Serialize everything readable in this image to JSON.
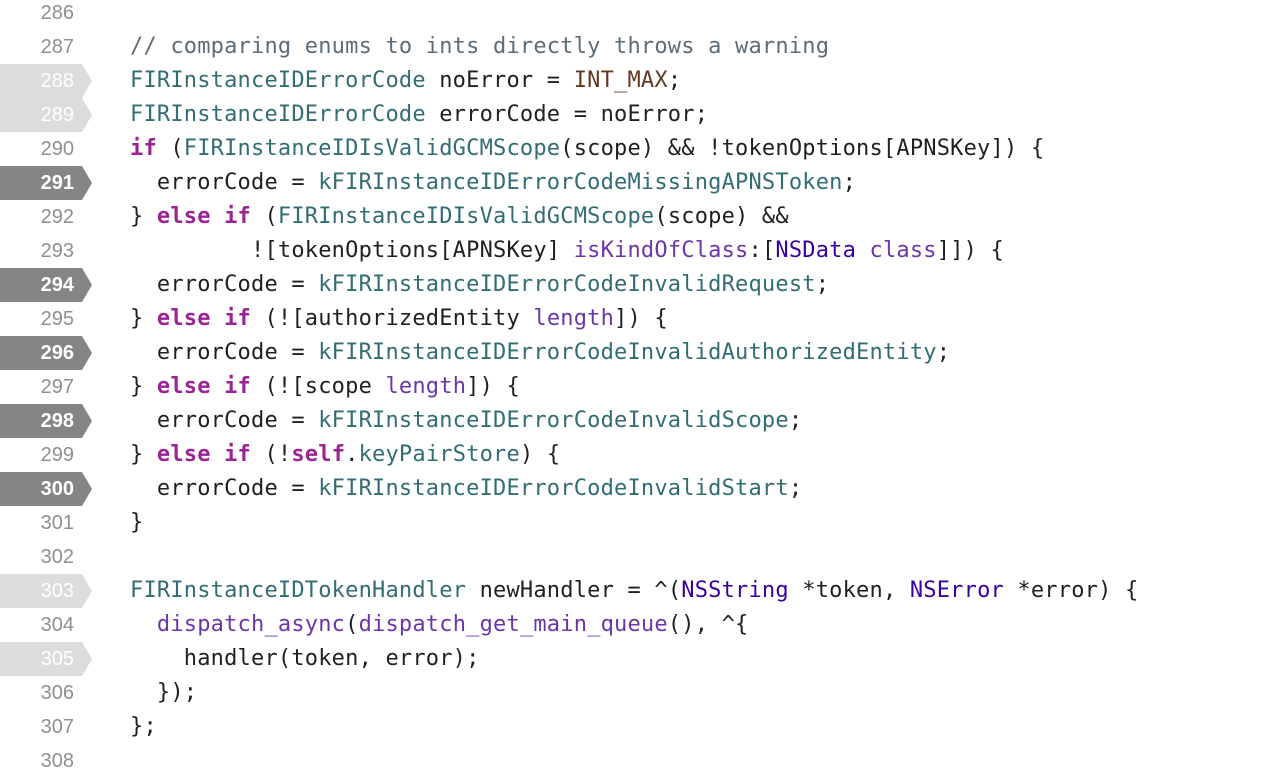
{
  "colors": {
    "background": "#ffffff",
    "gutter_text": "#8f8f8f",
    "breakpoint_active": "#858585",
    "breakpoint_inactive": "#dcdcdc",
    "plain": "#1f1f24",
    "comment": "#5d6c79",
    "keyword": "#9b2393",
    "type": "#326d74",
    "macro": "#643820",
    "func": "#6c36a9",
    "class": "#3900a0"
  },
  "lines": [
    {
      "num": "286",
      "bp": "none",
      "tokens": []
    },
    {
      "num": "287",
      "bp": "none",
      "tokens": [
        {
          "c": "comment",
          "t": "// comparing enums to ints directly throws a warning"
        }
      ]
    },
    {
      "num": "288",
      "bp": "inactive",
      "tokens": [
        {
          "c": "type",
          "t": "FIRInstanceIDErrorCode"
        },
        {
          "c": "plain",
          "t": " noError = "
        },
        {
          "c": "macro",
          "t": "INT_MAX"
        },
        {
          "c": "plain",
          "t": ";"
        }
      ]
    },
    {
      "num": "289",
      "bp": "inactive",
      "tokens": [
        {
          "c": "type",
          "t": "FIRInstanceIDErrorCode"
        },
        {
          "c": "plain",
          "t": " errorCode = noError;"
        }
      ]
    },
    {
      "num": "290",
      "bp": "none",
      "tokens": [
        {
          "c": "keyword",
          "t": "if"
        },
        {
          "c": "plain",
          "t": " ("
        },
        {
          "c": "type",
          "t": "FIRInstanceIDIsValidGCMScope"
        },
        {
          "c": "plain",
          "t": "(scope) && !tokenOptions[APNSKey]) {"
        }
      ]
    },
    {
      "num": "291",
      "bp": "active",
      "tokens": [
        {
          "c": "plain",
          "t": "  errorCode = "
        },
        {
          "c": "type",
          "t": "kFIRInstanceIDErrorCodeMissingAPNSToken"
        },
        {
          "c": "plain",
          "t": ";"
        }
      ]
    },
    {
      "num": "292",
      "bp": "none",
      "tokens": [
        {
          "c": "plain",
          "t": "} "
        },
        {
          "c": "keyword",
          "t": "else if"
        },
        {
          "c": "plain",
          "t": " ("
        },
        {
          "c": "type",
          "t": "FIRInstanceIDIsValidGCMScope"
        },
        {
          "c": "plain",
          "t": "(scope) &&"
        }
      ]
    },
    {
      "num": "293",
      "bp": "none",
      "tokens": [
        {
          "c": "plain",
          "t": "         ![tokenOptions[APNSKey] "
        },
        {
          "c": "func",
          "t": "isKindOfClass"
        },
        {
          "c": "plain",
          "t": ":["
        },
        {
          "c": "class",
          "t": "NSData"
        },
        {
          "c": "plain",
          "t": " "
        },
        {
          "c": "func",
          "t": "class"
        },
        {
          "c": "plain",
          "t": "]]) {"
        }
      ]
    },
    {
      "num": "294",
      "bp": "active",
      "tokens": [
        {
          "c": "plain",
          "t": "  errorCode = "
        },
        {
          "c": "type",
          "t": "kFIRInstanceIDErrorCodeInvalidRequest"
        },
        {
          "c": "plain",
          "t": ";"
        }
      ]
    },
    {
      "num": "295",
      "bp": "none",
      "tokens": [
        {
          "c": "plain",
          "t": "} "
        },
        {
          "c": "keyword",
          "t": "else if"
        },
        {
          "c": "plain",
          "t": " (![authorizedEntity "
        },
        {
          "c": "func",
          "t": "length"
        },
        {
          "c": "plain",
          "t": "]) {"
        }
      ]
    },
    {
      "num": "296",
      "bp": "active",
      "tokens": [
        {
          "c": "plain",
          "t": "  errorCode = "
        },
        {
          "c": "type",
          "t": "kFIRInstanceIDErrorCodeInvalidAuthorizedEntity"
        },
        {
          "c": "plain",
          "t": ";"
        }
      ]
    },
    {
      "num": "297",
      "bp": "none",
      "tokens": [
        {
          "c": "plain",
          "t": "} "
        },
        {
          "c": "keyword",
          "t": "else if"
        },
        {
          "c": "plain",
          "t": " (![scope "
        },
        {
          "c": "func",
          "t": "length"
        },
        {
          "c": "plain",
          "t": "]) {"
        }
      ]
    },
    {
      "num": "298",
      "bp": "active",
      "tokens": [
        {
          "c": "plain",
          "t": "  errorCode = "
        },
        {
          "c": "type",
          "t": "kFIRInstanceIDErrorCodeInvalidScope"
        },
        {
          "c": "plain",
          "t": ";"
        }
      ]
    },
    {
      "num": "299",
      "bp": "none",
      "tokens": [
        {
          "c": "plain",
          "t": "} "
        },
        {
          "c": "keyword",
          "t": "else if"
        },
        {
          "c": "plain",
          "t": " (!"
        },
        {
          "c": "keyword",
          "t": "self"
        },
        {
          "c": "plain",
          "t": "."
        },
        {
          "c": "type",
          "t": "keyPairStore"
        },
        {
          "c": "plain",
          "t": ") {"
        }
      ]
    },
    {
      "num": "300",
      "bp": "active",
      "tokens": [
        {
          "c": "plain",
          "t": "  errorCode = "
        },
        {
          "c": "type",
          "t": "kFIRInstanceIDErrorCodeInvalidStart"
        },
        {
          "c": "plain",
          "t": ";"
        }
      ]
    },
    {
      "num": "301",
      "bp": "none",
      "tokens": [
        {
          "c": "plain",
          "t": "}"
        }
      ]
    },
    {
      "num": "302",
      "bp": "none",
      "tokens": []
    },
    {
      "num": "303",
      "bp": "inactive",
      "tokens": [
        {
          "c": "type",
          "t": "FIRInstanceIDTokenHandler"
        },
        {
          "c": "plain",
          "t": " newHandler = ^("
        },
        {
          "c": "class",
          "t": "NSString"
        },
        {
          "c": "plain",
          "t": " *token, "
        },
        {
          "c": "class",
          "t": "NSError"
        },
        {
          "c": "plain",
          "t": " *error) {"
        }
      ]
    },
    {
      "num": "304",
      "bp": "none",
      "tokens": [
        {
          "c": "plain",
          "t": "  "
        },
        {
          "c": "func",
          "t": "dispatch_async"
        },
        {
          "c": "plain",
          "t": "("
        },
        {
          "c": "func",
          "t": "dispatch_get_main_queue"
        },
        {
          "c": "plain",
          "t": "(), ^{"
        }
      ]
    },
    {
      "num": "305",
      "bp": "inactive",
      "tokens": [
        {
          "c": "plain",
          "t": "    handler(token, error);"
        }
      ]
    },
    {
      "num": "306",
      "bp": "none",
      "tokens": [
        {
          "c": "plain",
          "t": "  });"
        }
      ]
    },
    {
      "num": "307",
      "bp": "none",
      "tokens": [
        {
          "c": "plain",
          "t": "};"
        }
      ]
    },
    {
      "num": "308",
      "bp": "none",
      "tokens": []
    }
  ]
}
